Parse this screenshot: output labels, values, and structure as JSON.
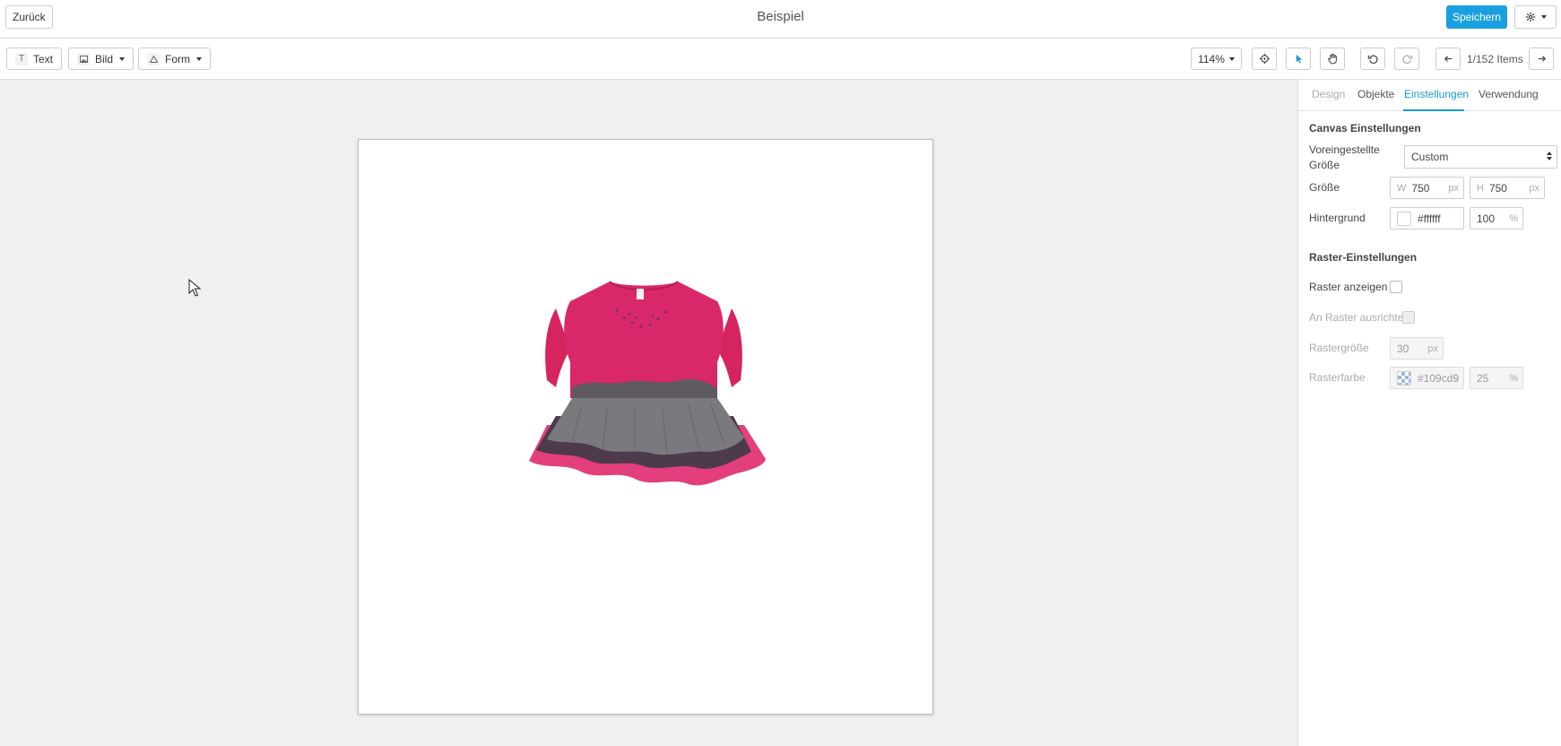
{
  "topbar": {
    "back_label": "Zurück",
    "title": "Beispiel",
    "save_label": "Speichern"
  },
  "toolbar": {
    "text_label": "Text",
    "image_label": "Bild",
    "shape_label": "Form",
    "zoom": "114%",
    "items_label": "1/152 Items"
  },
  "panel": {
    "tabs": [
      {
        "label": "Design",
        "state": "disabled"
      },
      {
        "label": "Objekte",
        "state": "normal"
      },
      {
        "label": "Einstellungen",
        "state": "active"
      },
      {
        "label": "Verwendung",
        "state": "normal"
      }
    ],
    "canvas_section": {
      "title": "Canvas Einstellungen",
      "preset_label": "Voreingestellte Größe",
      "preset_value": "Custom",
      "size_label": "Größe",
      "width_prefix": "W",
      "width_value": "750",
      "height_prefix": "H",
      "height_value": "750",
      "unit_px": "px",
      "background_label": "Hintergrund",
      "background_color": "#ffffff",
      "background_opacity": "100",
      "unit_percent": "%"
    },
    "grid_section": {
      "title": "Raster-Einstellungen",
      "show_grid_label": "Raster anzeigen",
      "snap_label": "An Raster ausrichten",
      "grid_size_label": "Rastergröße",
      "grid_size_value": "30",
      "grid_color_label": "Rasterfarbe",
      "grid_color_value": "#109cd9",
      "grid_opacity_value": "25"
    }
  },
  "colors": {
    "accent": "#1aa0e0",
    "tab_active": "#1a9ad6",
    "workspace_bg": "#f0f0f0"
  },
  "icons": {
    "text": "text-icon",
    "image": "image-icon",
    "shape": "shape-icon",
    "settings": "gear-icon",
    "center": "target-icon",
    "select": "pointer-icon",
    "pan": "hand-icon",
    "undo": "undo-icon",
    "redo": "redo-icon",
    "prev": "arrow-left-icon",
    "next": "arrow-right-icon"
  }
}
